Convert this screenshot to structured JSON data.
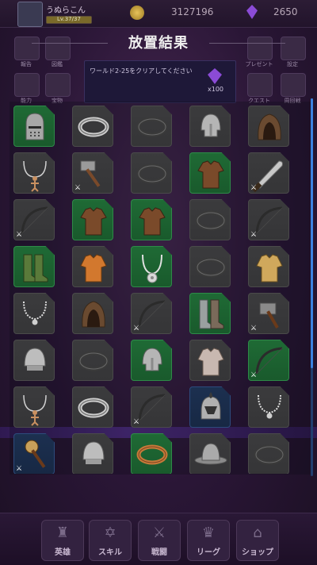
{
  "header": {
    "player_name": "うぬらこん",
    "level_text": "Lv.37/37",
    "gold": "3127196",
    "gems": "2650"
  },
  "dialog": {
    "title": "放置結果",
    "quest_text": "ワールド2-25をクリアしてください",
    "reward_count": "x100"
  },
  "side_menu": {
    "left": [
      "報告",
      "図鑑",
      "能力",
      "宝物"
    ],
    "right": [
      "プレゼント",
      "設定",
      "クエスト",
      "周回戦"
    ]
  },
  "bottom_nav": [
    {
      "label": "英雄",
      "glyph": "♜"
    },
    {
      "label": "スキル",
      "glyph": "✡"
    },
    {
      "label": "戦闘",
      "glyph": "⚔"
    },
    {
      "label": "リーグ",
      "glyph": "♛"
    },
    {
      "label": "ショップ",
      "glyph": "⌂"
    }
  ],
  "items": [
    {
      "type": "helmet-closed",
      "rarity": "uncommon",
      "weapon": false
    },
    {
      "type": "ring",
      "rarity": "common",
      "weapon": false
    },
    {
      "type": "ring-dark",
      "rarity": "common",
      "weapon": false
    },
    {
      "type": "helmet-nasal",
      "rarity": "common",
      "weapon": false
    },
    {
      "type": "hood",
      "rarity": "common",
      "weapon": false
    },
    {
      "type": "amulet-doll",
      "rarity": "common",
      "weapon": false
    },
    {
      "type": "hammer",
      "rarity": "common",
      "weapon": true
    },
    {
      "type": "ring-dark",
      "rarity": "common",
      "weapon": false
    },
    {
      "type": "tunic-brown",
      "rarity": "uncommon",
      "weapon": false
    },
    {
      "type": "machete",
      "rarity": "common",
      "weapon": true
    },
    {
      "type": "bow",
      "rarity": "common",
      "weapon": true
    },
    {
      "type": "tunic-brown",
      "rarity": "uncommon",
      "weapon": false
    },
    {
      "type": "tunic-brown",
      "rarity": "uncommon",
      "weapon": false
    },
    {
      "type": "ring-dark",
      "rarity": "common",
      "weapon": false
    },
    {
      "type": "bow",
      "rarity": "common",
      "weapon": true
    },
    {
      "type": "boots-green",
      "rarity": "uncommon",
      "weapon": false
    },
    {
      "type": "tunic-orange",
      "rarity": "common",
      "weapon": false
    },
    {
      "type": "amulet-disc",
      "rarity": "uncommon",
      "weapon": false
    },
    {
      "type": "ring-dark",
      "rarity": "common",
      "weapon": false
    },
    {
      "type": "tunic-tan",
      "rarity": "common",
      "weapon": false
    },
    {
      "type": "amulet-chain",
      "rarity": "common",
      "weapon": false
    },
    {
      "type": "hood",
      "rarity": "common",
      "weapon": false
    },
    {
      "type": "bow",
      "rarity": "common",
      "weapon": true
    },
    {
      "type": "boots-grey",
      "rarity": "uncommon",
      "weapon": false
    },
    {
      "type": "axe",
      "rarity": "common",
      "weapon": true
    },
    {
      "type": "helmet-round",
      "rarity": "common",
      "weapon": false
    },
    {
      "type": "ring-dark",
      "rarity": "common",
      "weapon": false
    },
    {
      "type": "helmet-nasal",
      "rarity": "uncommon",
      "weapon": false
    },
    {
      "type": "tunic-white",
      "rarity": "common",
      "weapon": false
    },
    {
      "type": "bow",
      "rarity": "uncommon",
      "weapon": true
    },
    {
      "type": "amulet-doll",
      "rarity": "common",
      "weapon": false
    },
    {
      "type": "ring",
      "rarity": "common",
      "weapon": false
    },
    {
      "type": "bow",
      "rarity": "common",
      "weapon": true
    },
    {
      "type": "helmet-plumed",
      "rarity": "rare",
      "weapon": false
    },
    {
      "type": "amulet-chain",
      "rarity": "common",
      "weapon": false
    },
    {
      "type": "mace",
      "rarity": "rare",
      "weapon": true
    },
    {
      "type": "helmet-round",
      "rarity": "common",
      "weapon": false
    },
    {
      "type": "ring-bronze",
      "rarity": "uncommon",
      "weapon": false
    },
    {
      "type": "helmet-kettle",
      "rarity": "common",
      "weapon": false
    },
    {
      "type": "ring-dark",
      "rarity": "common",
      "weapon": false
    }
  ],
  "weapon_badge": "⚔"
}
